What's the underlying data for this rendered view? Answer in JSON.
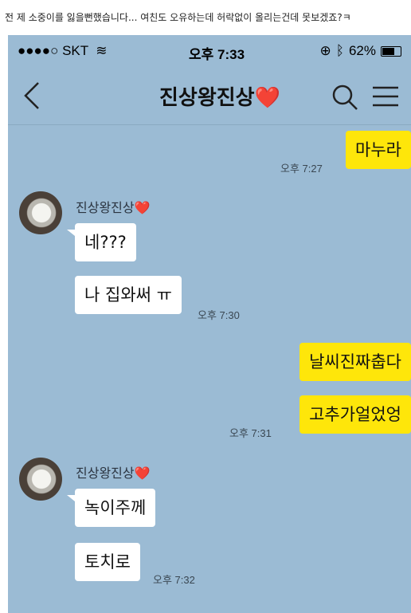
{
  "caption": "전 제 소중이를 잃을뻔했습니다... 여친도 오유하는데 허락없이 올리는건데 못보겠죠?ㅋ",
  "statusbar": {
    "signal": "●●●●○ SKT",
    "time": "오후 7:33",
    "battery": "62%",
    "battery_level": 0.62
  },
  "navbar": {
    "title": "진상왕진상❤️"
  },
  "messages": [
    {
      "text": "마누라",
      "time": "오후 7:27"
    },
    {
      "sender": "진상왕진상❤️",
      "text": "네???"
    },
    {
      "text": "나 집와써 ㅠ",
      "time": "오후 7:30"
    },
    {
      "text": "날씨진짜춥다"
    },
    {
      "text": "고추가얼었엉",
      "time": "오후 7:31"
    },
    {
      "sender": "진상왕진상❤️",
      "text": "녹이주께"
    },
    {
      "text": "토치로",
      "time": "오후 7:32"
    }
  ]
}
